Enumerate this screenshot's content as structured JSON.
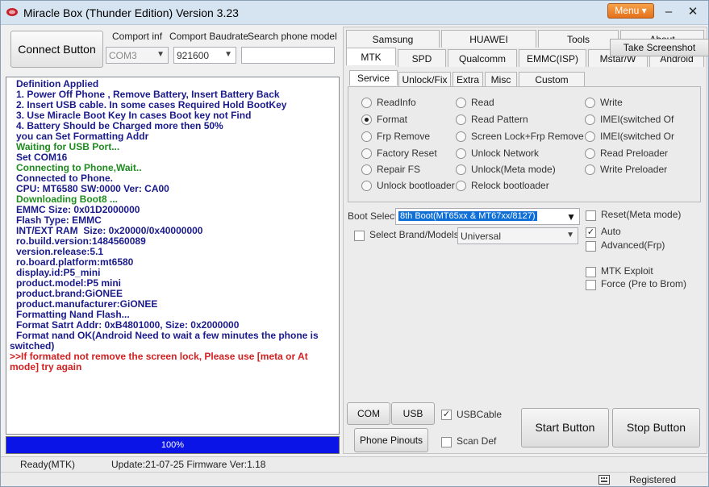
{
  "window": {
    "title": "Miracle Box (Thunder Edition) Version 3.23",
    "menu_label": "Menu"
  },
  "top": {
    "connect_label": "Connect Button",
    "comport_label": "Comport inf",
    "comport_value": "COM3",
    "baud_label": "Comport Baudrate",
    "baud_value": "921600",
    "search_label": "Search phone model",
    "search_value": ""
  },
  "log": [
    {
      "text": "Definition Applied",
      "color": "blue"
    },
    {
      "text": "1. Power Off Phone , Remove Battery, Insert Battery Back",
      "color": "blue"
    },
    {
      "text": "2. Insert USB cable. In some cases Required Hold BootKey",
      "color": "blue"
    },
    {
      "text": "3. Use Miracle Boot Key In cases Boot key not Find",
      "color": "blue"
    },
    {
      "text": "4. Battery Should be Charged more then 50%",
      "color": "blue"
    },
    {
      "text": "you can Set Formatting Addr",
      "color": "blue"
    },
    {
      "text": "Waiting for USB Port...",
      "color": "green"
    },
    {
      "text": "Set COM16",
      "color": "blue"
    },
    {
      "text": "Connecting to Phone,Wait..",
      "color": "green"
    },
    {
      "text": "Connected to Phone.",
      "color": "blue"
    },
    {
      "text": "CPU: MT6580 SW:0000 Ver: CA00",
      "color": "blue"
    },
    {
      "text": "Downloading Boot8 ...",
      "color": "green"
    },
    {
      "text": "EMMC Size: 0x01D2000000",
      "color": "blue"
    },
    {
      "text": "Flash Type: EMMC",
      "color": "blue"
    },
    {
      "text": "INT/EXT RAM  Size: 0x20000/0x40000000",
      "color": "blue"
    },
    {
      "text": "ro.build.version:1484560089",
      "color": "blue"
    },
    {
      "text": "version.release:5.1",
      "color": "blue"
    },
    {
      "text": "ro.board.platform:mt6580",
      "color": "blue"
    },
    {
      "text": "display.id:P5_mini",
      "color": "blue"
    },
    {
      "text": "product.model:P5 mini",
      "color": "blue"
    },
    {
      "text": "product.brand:GiONEE",
      "color": "blue"
    },
    {
      "text": "product.manufacturer:GiONEE",
      "color": "blue"
    },
    {
      "text": "Formatting Nand Flash...",
      "color": "blue"
    },
    {
      "text": "Format Satrt Addr: 0xB4801000, Size: 0x2000000",
      "color": "blue"
    },
    {
      "text": "Format nand OK(Android Need to wait a few minutes the phone is switched)",
      "color": "blue"
    },
    {
      "text": ">>If formated not remove the screen lock, Please use [meta or At mode] try again",
      "color": "red"
    }
  ],
  "progress": {
    "label": "100%",
    "value": 1.0
  },
  "status": {
    "mode": "Ready(MTK)",
    "update": "Update:21-07-25 Firmware Ver:1.18",
    "registered": "Registered"
  },
  "tabs_row1": [
    "Samsung",
    "HUAWEI",
    "Tools",
    "About"
  ],
  "tabs_row2": [
    "MTK",
    "SPD",
    "Qualcomm",
    "EMMC(ISP)",
    "Mstar/W",
    "Android"
  ],
  "screenshot_label": "Take Screenshot",
  "subtabs": [
    "Service",
    "Unlock/Fix",
    "Extra",
    "Misc",
    "Custom Setting"
  ],
  "service_options": {
    "col1": [
      "ReadInfo",
      "Format",
      "Frp Remove",
      "Factory Reset",
      "Repair FS",
      "Unlock bootloader"
    ],
    "col2": [
      "Read",
      "Read Pattern",
      "Screen Lock+Frp Remove",
      "Unlock Network",
      "Unlock(Meta mode)",
      "Relock bootloader"
    ],
    "col3": [
      "Write",
      "IMEI(switched Of",
      "IMEI(switched Or",
      "Read Preloader",
      "Write Preloader"
    ],
    "selected": "Format"
  },
  "boot": {
    "label": "Boot Select:",
    "value": "8th Boot(MT65xx & MT67xx/8127)",
    "brand_label": "Select Brand/Models",
    "brand_value": "Universal"
  },
  "checks": {
    "reset_meta": {
      "label": "Reset(Meta mode)",
      "checked": false
    },
    "auto": {
      "label": "Auto",
      "checked": true
    },
    "advanced_frp": {
      "label": "Advanced(Frp)",
      "checked": false
    },
    "mtk_exploit": {
      "label": "MTK Exploit",
      "checked": false
    },
    "force_brom": {
      "label": "Force (Pre to Brom)",
      "checked": false
    },
    "usbcable": {
      "label": "USBCable",
      "checked": true
    },
    "scan_def": {
      "label": "Scan Def",
      "checked": false
    }
  },
  "bottom_buttons": {
    "com_scan": "COM Scan",
    "usb_scan": "USB Scan",
    "phone_pinouts": "Phone Pinouts",
    "start": "Start Button",
    "stop": "Stop Button"
  }
}
